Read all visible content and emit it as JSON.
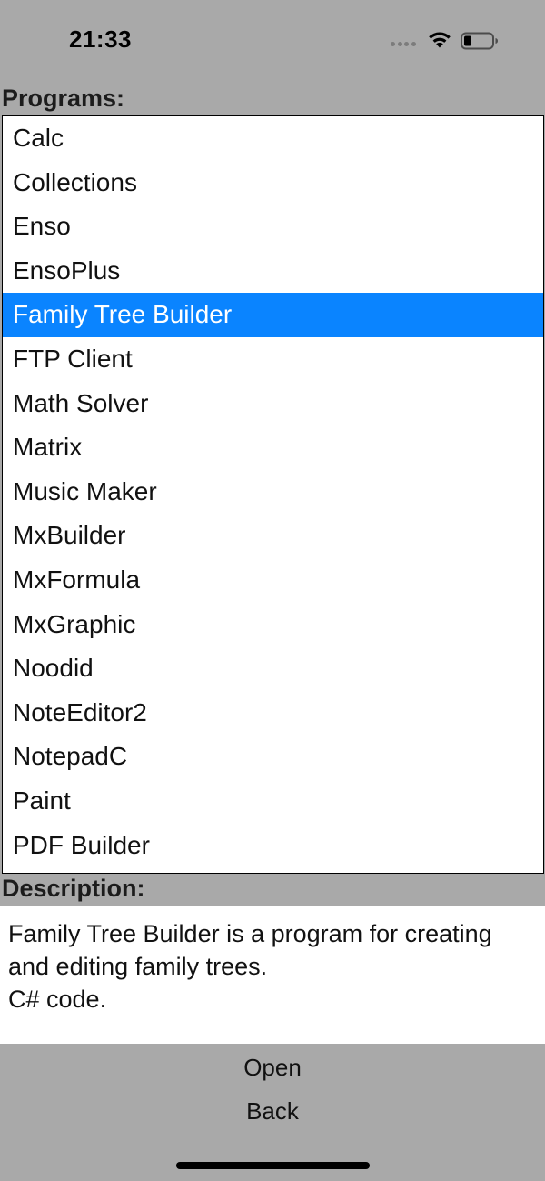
{
  "status_bar": {
    "time": "21:33",
    "signal_icon": "signal-dots-icon",
    "wifi_icon": "wifi-icon",
    "battery_icon": "battery-low-icon"
  },
  "programs_label": "Programs:",
  "programs": [
    "Calc",
    "Collections",
    "Enso",
    "EnsoPlus",
    "Family Tree Builder",
    "FTP Client",
    "Math Solver",
    "Matrix",
    "Music Maker",
    "MxBuilder",
    "MxFormula",
    "MxGraphic",
    "Noodid",
    "NoteEditor2",
    "NotepadC",
    "Paint",
    "PDF Builder"
  ],
  "selected_program": "Family Tree Builder",
  "description_label": "Description:",
  "description_text": "Family Tree Builder is a program for creating and editing family trees.\nC# code.",
  "buttons": {
    "open": "Open",
    "back": "Back"
  },
  "colors": {
    "background": "#a9a9a9",
    "selection": "#0a84ff",
    "list_background": "#ffffff"
  }
}
